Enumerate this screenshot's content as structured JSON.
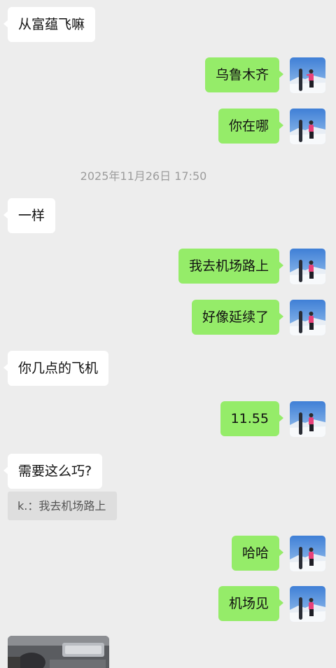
{
  "chat": {
    "messages": [
      {
        "side": "left",
        "text": "从富蕴飞嘛"
      },
      {
        "side": "right",
        "text": "乌鲁木齐"
      },
      {
        "side": "right",
        "text": "你在哪"
      },
      {
        "side": "time",
        "text": "2025年11月26日 17:50"
      },
      {
        "side": "left",
        "text": "一样"
      },
      {
        "side": "right",
        "text": "我去机场路上"
      },
      {
        "side": "right",
        "text": "好像延续了"
      },
      {
        "side": "left",
        "text": "你几点的飞机"
      },
      {
        "side": "right",
        "text": "11.55"
      },
      {
        "side": "left",
        "text": "需要这么巧?"
      },
      {
        "side": "quote",
        "text": "k.：我去机场路上"
      },
      {
        "side": "right",
        "text": "哈哈"
      },
      {
        "side": "right",
        "text": "机场见"
      }
    ],
    "self_avatar_icon": "avatar-snowboarder-photo",
    "last_item": "photo-message-car-interior"
  },
  "colors": {
    "background": "#ededed",
    "self_bubble": "#95ec69",
    "other_bubble": "#ffffff",
    "quote_bg": "#dedede",
    "timestamp": "#9c9c9c"
  }
}
